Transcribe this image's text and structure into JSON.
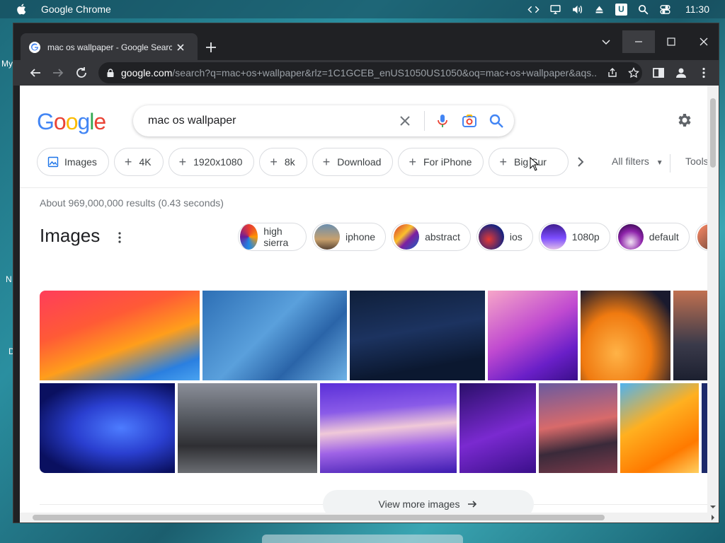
{
  "menubar": {
    "app_name": "Google Chrome",
    "time": "11:30",
    "u_badge": "U"
  },
  "desktop": {
    "labels": [
      "My",
      "N",
      "D"
    ]
  },
  "browser": {
    "tab_title": "mac os wallpaper - Google Search",
    "url_host": "google.com",
    "url_path": "/search?q=mac+os+wallpaper&rlz=1C1GCEB_enUS1050US1050&oq=mac+os+wallpaper&aqs..."
  },
  "search": {
    "logo": "Google",
    "query": "mac os wallpaper",
    "stats": "About 969,000,000 results (0.43 seconds)"
  },
  "filters": {
    "chips": [
      "Images",
      "4K",
      "1920x1080",
      "8k",
      "Download",
      "For iPhone",
      "Big Sur"
    ],
    "all_filters": "All filters",
    "tools": "Tools"
  },
  "images_section": {
    "heading": "Images",
    "related": [
      "high sierra",
      "iphone",
      "abstract",
      "ios",
      "1080p",
      "default"
    ],
    "view_more": "View more images"
  },
  "colors": {
    "accent": "#1a73e8",
    "chrome_dark": "#202124",
    "chrome_toolbar": "#35363a"
  }
}
